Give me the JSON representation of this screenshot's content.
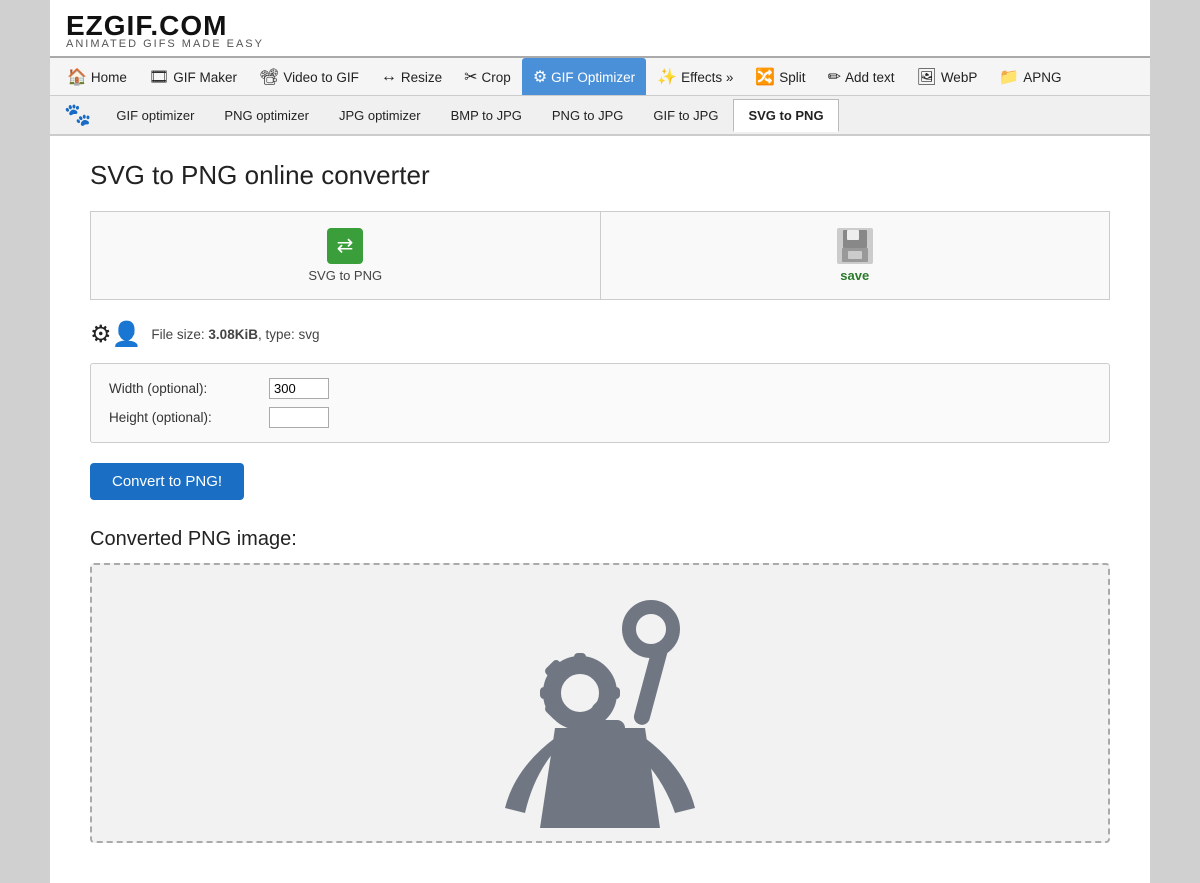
{
  "logo": {
    "main": "EZGIF.COM",
    "sub": "ANIMATED GIFS MADE EASY"
  },
  "nav": {
    "items": [
      {
        "id": "home",
        "label": "Home",
        "icon": "🏠",
        "active": false
      },
      {
        "id": "gif-maker",
        "label": "GIF Maker",
        "icon": "🎞",
        "active": false
      },
      {
        "id": "video-to-gif",
        "label": "Video to GIF",
        "icon": "📽",
        "active": false
      },
      {
        "id": "resize",
        "label": "Resize",
        "icon": "↔",
        "active": false
      },
      {
        "id": "crop",
        "label": "Crop",
        "icon": "✂",
        "active": false
      },
      {
        "id": "gif-optimizer",
        "label": "GIF Optimizer",
        "icon": "⚙",
        "active": true
      },
      {
        "id": "effects",
        "label": "Effects »",
        "icon": "✨",
        "active": false
      },
      {
        "id": "split",
        "label": "Split",
        "icon": "🔀",
        "active": false
      },
      {
        "id": "add-text",
        "label": "Add text",
        "icon": "✏",
        "active": false
      },
      {
        "id": "webp",
        "label": "WebP",
        "icon": "🖼",
        "active": false
      },
      {
        "id": "apng",
        "label": "APNG",
        "icon": "📁",
        "active": false
      }
    ]
  },
  "subnav": {
    "logo": "🐾",
    "items": [
      {
        "id": "gif-optimizer",
        "label": "GIF optimizer",
        "active": false
      },
      {
        "id": "png-optimizer",
        "label": "PNG optimizer",
        "active": false
      },
      {
        "id": "jpg-optimizer",
        "label": "JPG optimizer",
        "active": false
      },
      {
        "id": "bmp-to-jpg",
        "label": "BMP to JPG",
        "active": false
      },
      {
        "id": "png-to-jpg",
        "label": "PNG to JPG",
        "active": false
      },
      {
        "id": "gif-to-jpg",
        "label": "GIF to JPG",
        "active": false
      },
      {
        "id": "svg-to-png",
        "label": "SVG to PNG",
        "active": true
      }
    ]
  },
  "page": {
    "title": "SVG to PNG online converter",
    "upload_label": "SVG to PNG",
    "save_label": "save",
    "file_info": {
      "size": "3.08KiB",
      "type": "svg",
      "prefix": "File size: ",
      "suffix": ", type: svg"
    },
    "options": {
      "width_label": "Width (optional):",
      "width_value": "300",
      "height_label": "Height (optional):",
      "height_value": ""
    },
    "convert_button": "Convert to PNG!",
    "result_title": "Converted PNG image:"
  }
}
